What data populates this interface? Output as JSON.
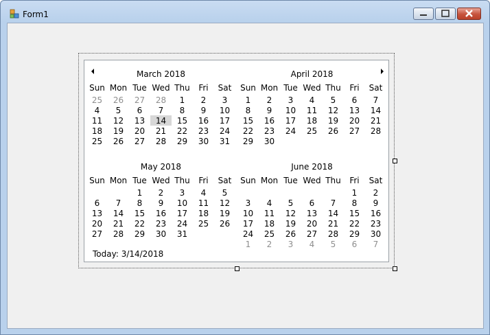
{
  "window": {
    "title": "Form1"
  },
  "weekdays": [
    "Sun",
    "Mon",
    "Tue",
    "Wed",
    "Thu",
    "Fri",
    "Sat"
  ],
  "calendar": {
    "today_text": "Today: 3/14/2018",
    "months": [
      {
        "title": "March 2018",
        "weeks": [
          [
            "25",
            "26",
            "27",
            "28",
            "1",
            "2",
            "3"
          ],
          [
            "4",
            "5",
            "6",
            "7",
            "8",
            "9",
            "10"
          ],
          [
            "11",
            "12",
            "13",
            "14",
            "15",
            "16",
            "17"
          ],
          [
            "18",
            "19",
            "20",
            "21",
            "22",
            "23",
            "24"
          ],
          [
            "25",
            "26",
            "27",
            "28",
            "29",
            "30",
            "31"
          ]
        ],
        "other_month": [
          [
            1,
            1,
            1,
            1,
            0,
            0,
            0
          ],
          [
            0,
            0,
            0,
            0,
            0,
            0,
            0
          ],
          [
            0,
            0,
            0,
            0,
            0,
            0,
            0
          ],
          [
            0,
            0,
            0,
            0,
            0,
            0,
            0
          ],
          [
            0,
            0,
            0,
            0,
            0,
            0,
            0
          ]
        ],
        "today": [
          2,
          3
        ]
      },
      {
        "title": "April 2018",
        "weeks": [
          [
            "1",
            "2",
            "3",
            "4",
            "5",
            "6",
            "7"
          ],
          [
            "8",
            "9",
            "10",
            "11",
            "12",
            "13",
            "14"
          ],
          [
            "15",
            "16",
            "17",
            "18",
            "19",
            "20",
            "21"
          ],
          [
            "22",
            "23",
            "24",
            "25",
            "26",
            "27",
            "28"
          ],
          [
            "29",
            "30",
            "",
            "",
            "",
            "",
            ""
          ]
        ],
        "other_month": [
          [
            0,
            0,
            0,
            0,
            0,
            0,
            0
          ],
          [
            0,
            0,
            0,
            0,
            0,
            0,
            0
          ],
          [
            0,
            0,
            0,
            0,
            0,
            0,
            0
          ],
          [
            0,
            0,
            0,
            0,
            0,
            0,
            0
          ],
          [
            0,
            0,
            0,
            0,
            0,
            0,
            0
          ]
        ]
      },
      {
        "title": "May 2018",
        "weeks": [
          [
            "",
            "",
            "1",
            "2",
            "3",
            "4",
            "5"
          ],
          [
            "6",
            "7",
            "8",
            "9",
            "10",
            "11",
            "12"
          ],
          [
            "13",
            "14",
            "15",
            "16",
            "17",
            "18",
            "19"
          ],
          [
            "20",
            "21",
            "22",
            "23",
            "24",
            "25",
            "26"
          ],
          [
            "27",
            "28",
            "29",
            "30",
            "31",
            "",
            ""
          ]
        ],
        "other_month": [
          [
            0,
            0,
            0,
            0,
            0,
            0,
            0
          ],
          [
            0,
            0,
            0,
            0,
            0,
            0,
            0
          ],
          [
            0,
            0,
            0,
            0,
            0,
            0,
            0
          ],
          [
            0,
            0,
            0,
            0,
            0,
            0,
            0
          ],
          [
            0,
            0,
            0,
            0,
            0,
            0,
            0
          ]
        ]
      },
      {
        "title": "June 2018",
        "weeks": [
          [
            "",
            "",
            "",
            "",
            "",
            "1",
            "2"
          ],
          [
            "3",
            "4",
            "5",
            "6",
            "7",
            "8",
            "9"
          ],
          [
            "10",
            "11",
            "12",
            "13",
            "14",
            "15",
            "16"
          ],
          [
            "17",
            "18",
            "19",
            "20",
            "21",
            "22",
            "23"
          ],
          [
            "24",
            "25",
            "26",
            "27",
            "28",
            "29",
            "30"
          ],
          [
            "1",
            "2",
            "3",
            "4",
            "5",
            "6",
            "7"
          ]
        ],
        "other_month": [
          [
            0,
            0,
            0,
            0,
            0,
            0,
            0
          ],
          [
            0,
            0,
            0,
            0,
            0,
            0,
            0
          ],
          [
            0,
            0,
            0,
            0,
            0,
            0,
            0
          ],
          [
            0,
            0,
            0,
            0,
            0,
            0,
            0
          ],
          [
            0,
            0,
            0,
            0,
            0,
            0,
            0
          ],
          [
            1,
            1,
            1,
            1,
            1,
            1,
            1
          ]
        ]
      }
    ]
  },
  "colors": {
    "today_highlight": "#d7d7d7",
    "other_month_text": "#8e8e8e",
    "form_background": "#f0f0f0"
  },
  "icons": {
    "app": "form-app-icon",
    "prev": "left-arrow-icon",
    "next": "right-arrow-icon"
  }
}
